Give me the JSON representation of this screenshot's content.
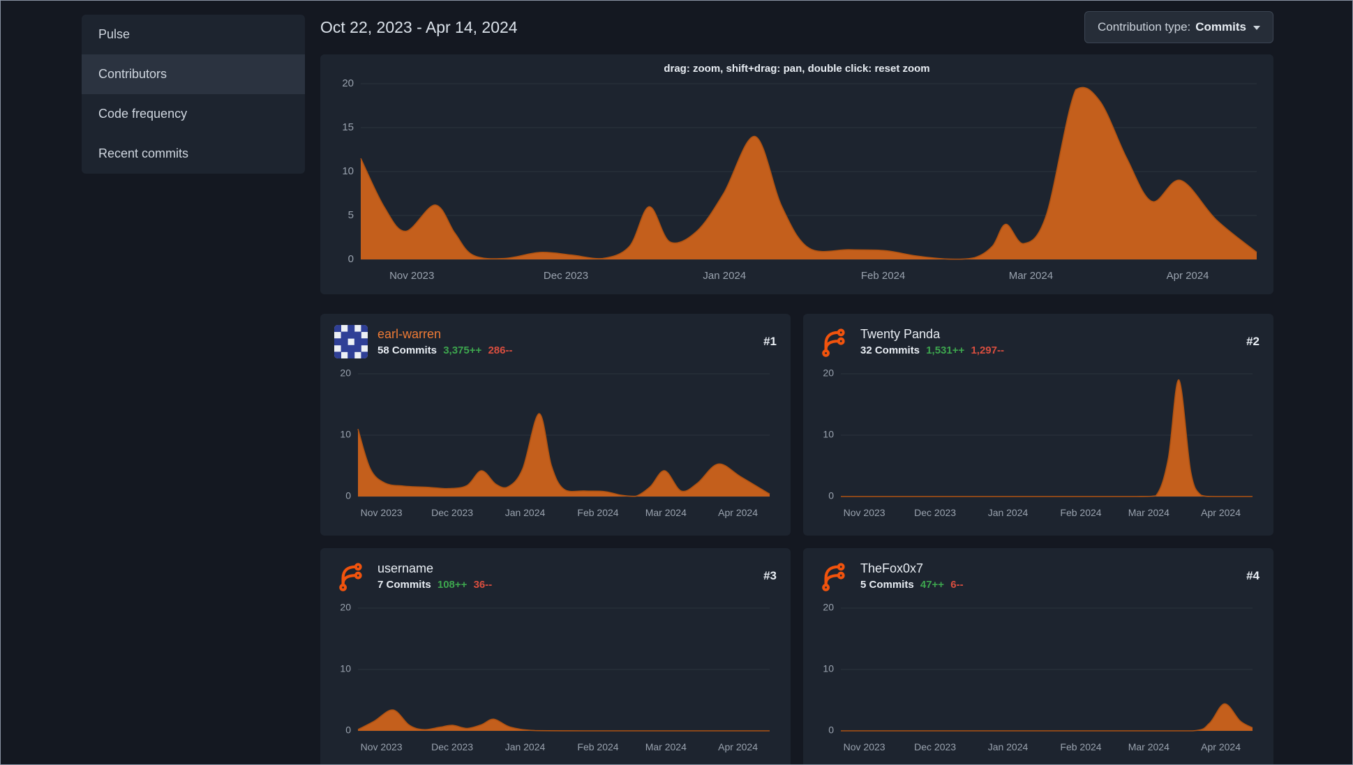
{
  "page": {
    "title_date_range": "Oct 22, 2023 - Apr 14, 2024"
  },
  "sidebar": {
    "items": [
      {
        "label": "Pulse",
        "active": false
      },
      {
        "label": "Contributors",
        "active": true
      },
      {
        "label": "Code frequency",
        "active": false
      },
      {
        "label": "Recent commits",
        "active": false
      }
    ]
  },
  "toolbar": {
    "contribution_type_label": "Contribution type:",
    "contribution_type_value": "Commits"
  },
  "main_chart": {
    "hint": "drag: zoom, shift+drag: pan, double click: reset zoom"
  },
  "contributors": [
    {
      "rank": "#1",
      "name": "earl-warren",
      "name_color": "#ef7b35",
      "commits": "58 Commits",
      "additions": "3,375++",
      "deletions": "286--",
      "avatar": "identicon"
    },
    {
      "rank": "#2",
      "name": "Twenty Panda",
      "name_color": "#e9eef4",
      "commits": "32 Commits",
      "additions": "1,531++",
      "deletions": "1,297--",
      "avatar": "forgejo-logo"
    },
    {
      "rank": "#3",
      "name": "username",
      "name_color": "#e9eef4",
      "commits": "7 Commits",
      "additions": "108++",
      "deletions": "36--",
      "avatar": "forgejo-logo"
    },
    {
      "rank": "#4",
      "name": "TheFox0x7",
      "name_color": "#e9eef4",
      "commits": "5 Commits",
      "additions": "47++",
      "deletions": "6--",
      "avatar": "forgejo-logo"
    }
  ],
  "identicon": {
    "fg": "#2f3f96",
    "bg": "#edf0f5",
    "rows": [
      "10101",
      "01110",
      "11011",
      "01110",
      "10101"
    ]
  },
  "colors": {
    "area": "#c45f1c",
    "area_line": "#b05312",
    "grid": "#2c333e",
    "axis_text": "#9aa3af",
    "green": "#3da64e",
    "red": "#d94e3f",
    "logo_orange": "#f1530d"
  },
  "chart_data": [
    {
      "id": "overall-commits",
      "type": "area",
      "title": "Commits over time (all contributors)",
      "ylim": [
        0,
        20
      ],
      "yticks": [
        0,
        5,
        10,
        15,
        20
      ],
      "xticks": [
        [
          0.057,
          "Nov 2023"
        ],
        [
          0.229,
          "Dec 2023"
        ],
        [
          0.406,
          "Jan 2024"
        ],
        [
          0.583,
          "Feb 2024"
        ],
        [
          0.748,
          "Mar 2024"
        ],
        [
          0.923,
          "Apr 2024"
        ]
      ],
      "points": [
        [
          0,
          11.5
        ],
        [
          0.026,
          6
        ],
        [
          0.05,
          3.2
        ],
        [
          0.083,
          6.2
        ],
        [
          0.105,
          3
        ],
        [
          0.125,
          0.5
        ],
        [
          0.16,
          0.1
        ],
        [
          0.2,
          0.8
        ],
        [
          0.235,
          0.5
        ],
        [
          0.27,
          0.1
        ],
        [
          0.3,
          1.5
        ],
        [
          0.322,
          6
        ],
        [
          0.345,
          2
        ],
        [
          0.375,
          3.2
        ],
        [
          0.405,
          7.5
        ],
        [
          0.44,
          14
        ],
        [
          0.47,
          6
        ],
        [
          0.5,
          1.3
        ],
        [
          0.545,
          1.1
        ],
        [
          0.585,
          1
        ],
        [
          0.62,
          0.4
        ],
        [
          0.655,
          0.05
        ],
        [
          0.685,
          0.2
        ],
        [
          0.705,
          1.5
        ],
        [
          0.72,
          4
        ],
        [
          0.74,
          1.8
        ],
        [
          0.765,
          5
        ],
        [
          0.798,
          19.3
        ],
        [
          0.825,
          18
        ],
        [
          0.855,
          11.5
        ],
        [
          0.883,
          6.6
        ],
        [
          0.915,
          9
        ],
        [
          0.955,
          4.5
        ],
        [
          1,
          0.8
        ]
      ]
    },
    {
      "id": "earl-warren-commits",
      "type": "area",
      "title": "earl-warren commits",
      "ylim": [
        0,
        20
      ],
      "yticks": [
        0,
        10,
        20
      ],
      "xticks": [
        [
          0.057,
          "Nov 2023"
        ],
        [
          0.229,
          "Dec 2023"
        ],
        [
          0.406,
          "Jan 2024"
        ],
        [
          0.583,
          "Feb 2024"
        ],
        [
          0.748,
          "Mar 2024"
        ],
        [
          0.923,
          "Apr 2024"
        ]
      ],
      "points": [
        [
          0,
          11
        ],
        [
          0.03,
          4.5
        ],
        [
          0.065,
          2.2
        ],
        [
          0.11,
          1.7
        ],
        [
          0.17,
          1.5
        ],
        [
          0.22,
          1.3
        ],
        [
          0.265,
          1.8
        ],
        [
          0.3,
          4.2
        ],
        [
          0.335,
          2
        ],
        [
          0.365,
          1.6
        ],
        [
          0.4,
          4.5
        ],
        [
          0.44,
          13.5
        ],
        [
          0.47,
          5
        ],
        [
          0.5,
          1.2
        ],
        [
          0.55,
          0.9
        ],
        [
          0.6,
          0.8
        ],
        [
          0.64,
          0.2
        ],
        [
          0.675,
          0.05
        ],
        [
          0.71,
          1.6
        ],
        [
          0.745,
          4.2
        ],
        [
          0.785,
          0.9
        ],
        [
          0.825,
          2.2
        ],
        [
          0.875,
          5.3
        ],
        [
          0.93,
          3.2
        ],
        [
          1,
          0.4
        ]
      ]
    },
    {
      "id": "twenty-panda-commits",
      "type": "area",
      "title": "Twenty Panda commits",
      "ylim": [
        0,
        20
      ],
      "yticks": [
        0,
        10,
        20
      ],
      "xticks": [
        [
          0.057,
          "Nov 2023"
        ],
        [
          0.229,
          "Dec 2023"
        ],
        [
          0.406,
          "Jan 2024"
        ],
        [
          0.583,
          "Feb 2024"
        ],
        [
          0.748,
          "Mar 2024"
        ],
        [
          0.923,
          "Apr 2024"
        ]
      ],
      "points": [
        [
          0,
          0
        ],
        [
          0.2,
          0
        ],
        [
          0.4,
          0
        ],
        [
          0.6,
          0
        ],
        [
          0.72,
          0
        ],
        [
          0.765,
          0.1
        ],
        [
          0.795,
          6
        ],
        [
          0.821,
          19
        ],
        [
          0.85,
          4
        ],
        [
          0.875,
          0.2
        ],
        [
          0.91,
          0
        ],
        [
          1,
          0
        ]
      ]
    },
    {
      "id": "username-commits",
      "type": "area",
      "title": "username commits",
      "ylim": [
        0,
        20
      ],
      "yticks": [
        0,
        10,
        20
      ],
      "xticks": [
        [
          0.057,
          "Nov 2023"
        ],
        [
          0.229,
          "Dec 2023"
        ],
        [
          0.406,
          "Jan 2024"
        ],
        [
          0.583,
          "Feb 2024"
        ],
        [
          0.748,
          "Mar 2024"
        ],
        [
          0.923,
          "Apr 2024"
        ]
      ],
      "points": [
        [
          0,
          0.2
        ],
        [
          0.04,
          1.6
        ],
        [
          0.085,
          3.4
        ],
        [
          0.125,
          0.9
        ],
        [
          0.16,
          0.2
        ],
        [
          0.2,
          0.6
        ],
        [
          0.23,
          0.9
        ],
        [
          0.265,
          0.4
        ],
        [
          0.3,
          1
        ],
        [
          0.33,
          1.9
        ],
        [
          0.37,
          0.6
        ],
        [
          0.43,
          0.05
        ],
        [
          0.55,
          0
        ],
        [
          0.7,
          0
        ],
        [
          0.85,
          0
        ],
        [
          1,
          0
        ]
      ]
    },
    {
      "id": "thefox0x7-commits",
      "type": "area",
      "title": "TheFox0x7 commits",
      "ylim": [
        0,
        20
      ],
      "yticks": [
        0,
        10,
        20
      ],
      "xticks": [
        [
          0.057,
          "Nov 2023"
        ],
        [
          0.229,
          "Dec 2023"
        ],
        [
          0.406,
          "Jan 2024"
        ],
        [
          0.583,
          "Feb 2024"
        ],
        [
          0.748,
          "Mar 2024"
        ],
        [
          0.923,
          "Apr 2024"
        ]
      ],
      "points": [
        [
          0,
          0
        ],
        [
          0.2,
          0
        ],
        [
          0.45,
          0
        ],
        [
          0.7,
          0
        ],
        [
          0.855,
          0
        ],
        [
          0.895,
          1.2
        ],
        [
          0.932,
          4.4
        ],
        [
          0.97,
          1.6
        ],
        [
          1,
          0.5
        ]
      ]
    }
  ]
}
